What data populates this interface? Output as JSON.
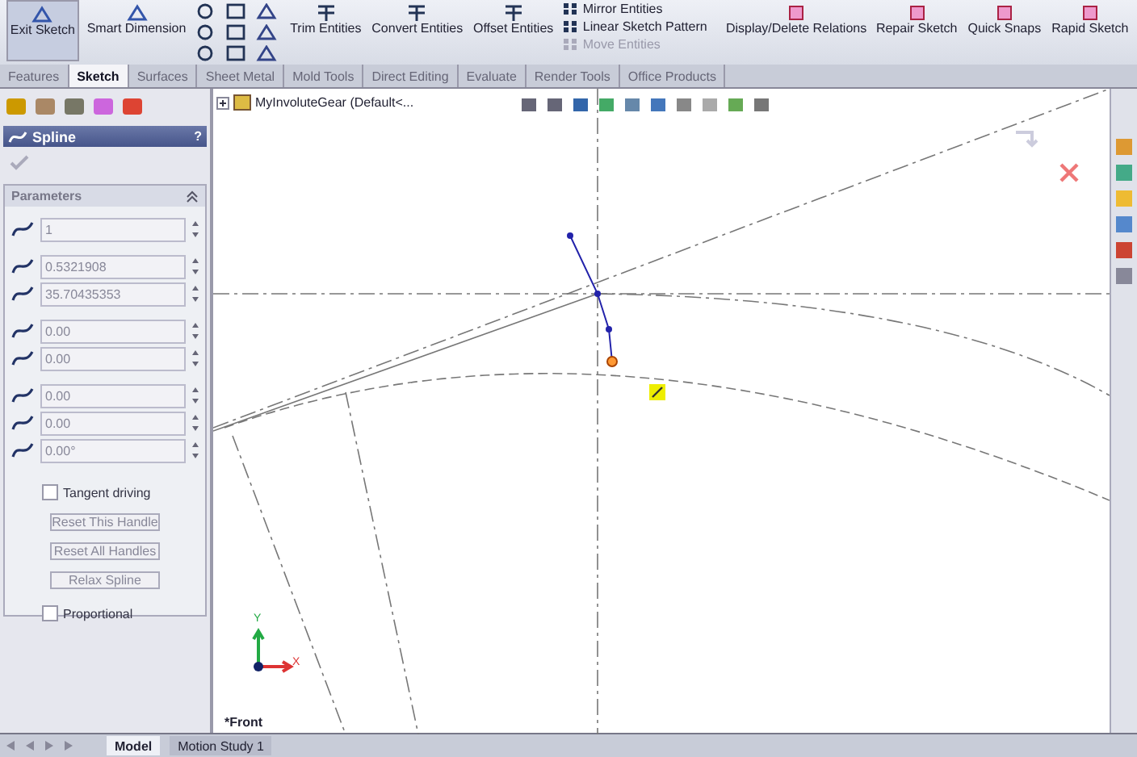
{
  "ribbon": {
    "left_buttons": [
      {
        "label": "Exit Sketch",
        "pressed": true
      },
      {
        "label": "Smart Dimension",
        "pressed": false
      }
    ],
    "middle_buttons": [
      {
        "label": "Trim Entities",
        "pressed": false
      },
      {
        "label": "Convert Entities",
        "pressed": false
      },
      {
        "label": "Offset Entities",
        "pressed": false
      }
    ],
    "small_items": [
      {
        "label": "Mirror Entities",
        "disabled": false
      },
      {
        "label": "Linear Sketch Pattern",
        "disabled": false
      },
      {
        "label": "Move Entities",
        "disabled": true
      }
    ],
    "right_buttons": [
      {
        "label": "Display/Delete Relations",
        "pressed": false
      },
      {
        "label": "Repair Sketch",
        "pressed": false
      },
      {
        "label": "Quick Snaps",
        "pressed": false
      },
      {
        "label": "Rapid Sketch",
        "pressed": false
      }
    ]
  },
  "tabs": [
    {
      "label": "Features",
      "selected": false
    },
    {
      "label": "Sketch",
      "selected": true
    },
    {
      "label": "Surfaces",
      "selected": false
    },
    {
      "label": "Sheet Metal",
      "selected": false
    },
    {
      "label": "Mold Tools",
      "selected": false
    },
    {
      "label": "Direct Editing",
      "selected": false
    },
    {
      "label": "Evaluate",
      "selected": false
    },
    {
      "label": "Render Tools",
      "selected": false
    },
    {
      "label": "Office Products",
      "selected": false
    }
  ],
  "property_manager": {
    "title": "Spline",
    "help": "?",
    "group_title": "Parameters",
    "field_groups": [
      [
        "1"
      ],
      [
        "0.5321908",
        "35.70435353"
      ],
      [
        "0.00",
        "0.00"
      ],
      [
        "0.00",
        "0.00",
        "0.00°"
      ]
    ],
    "tangent_driving": {
      "label": "Tangent driving",
      "checked": false
    },
    "buttons": [
      {
        "label": "Reset This Handle",
        "disabled": true
      },
      {
        "label": "Reset All Handles",
        "disabled": true
      },
      {
        "label": "Relax Spline",
        "disabled": true
      }
    ],
    "proportional": {
      "label": "Proportional",
      "checked": false
    }
  },
  "viewport": {
    "tree_item": "MyInvoluteGear  (Default<...",
    "view_label": "*Front",
    "axis_x": "X",
    "axis_y": "Y"
  },
  "bottom_tabs": [
    {
      "label": "Model",
      "selected": true
    },
    {
      "label": "Motion Study 1",
      "selected": false
    }
  ]
}
